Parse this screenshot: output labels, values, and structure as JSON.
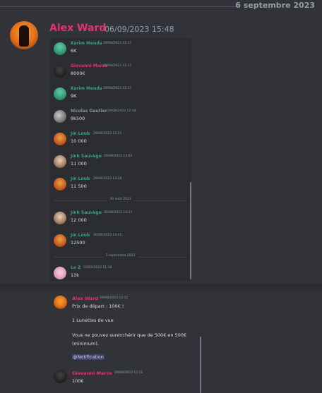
{
  "date_divider": "6 septembre 2023",
  "message": {
    "author": "Alex Ward",
    "timestamp": "06/09/2023 15:48"
  },
  "embed": {
    "rows": [
      {
        "name": "Karim Meuda",
        "time": "29/08/2023 12:17",
        "content": "6K",
        "color": "#3fa07a",
        "avatar": "green-avatar"
      },
      {
        "name": "Giovanni Marco",
        "time": "29/08/2023 12:17",
        "content": "8000€",
        "color": "#e6316d",
        "avatar": "dark-avatar"
      },
      {
        "name": "Karim Meuda",
        "time": "29/08/2023 12:17",
        "content": "9K",
        "color": "#3fa07a",
        "avatar": "green-avatar"
      },
      {
        "name": "Nicolas Gautier",
        "time": "29/08/2023 12:18",
        "content": "9k500",
        "color": "#8b939c",
        "avatar": "grey-avatar"
      },
      {
        "name": "Jin Loub",
        "time": "29/08/2023 12:21",
        "content": "10 000",
        "color": "#3fa07a",
        "avatar": "orange-avatar"
      },
      {
        "name": "Jinh Sauvage",
        "time": "29/08/2023 13:02",
        "content": "11 000",
        "color": "#3fa07a",
        "avatar": "face-avatar"
      },
      {
        "name": "Jin Loub",
        "time": "29/08/2023 13:28",
        "content": "11 500",
        "color": "#3fa07a",
        "avatar": "orange-avatar"
      },
      {
        "name": "Jinh Sauvage",
        "time": "30/08/2023 14:17",
        "content": "12 000",
        "color": "#3fa07a",
        "avatar": "face-avatar"
      },
      {
        "name": "Jin Loub",
        "time": "30/08/2023 14:41",
        "content": "12500",
        "color": "#3fa07a",
        "avatar": "orange-avatar"
      },
      {
        "name": "Lo Z",
        "time": "03/09/2023 11:38",
        "content": "13k",
        "color": "#3fa07a",
        "avatar": "pink-avatar"
      }
    ],
    "divider_1": "30 août 2023",
    "divider_2": "3 septembre 2023"
  },
  "reply": {
    "author": "Alex Ward",
    "time": "29/08/2023 12:11",
    "line1": "Prix de départ : 100€ !",
    "line2": "1 Lunettes de vue",
    "line3": "Vous ne pouvez surenchérir que de 500€ en 500€",
    "line4": "(minimum).",
    "mention": "@Notification",
    "second_author": "Giovanni Marco",
    "second_time": "29/08/2023 12:11",
    "second_content": "100€"
  },
  "colors": {
    "background": "#313338",
    "embed_bg": "#2b2d31",
    "author_pink": "#e6316d",
    "teal_name": "#3fa07a"
  }
}
